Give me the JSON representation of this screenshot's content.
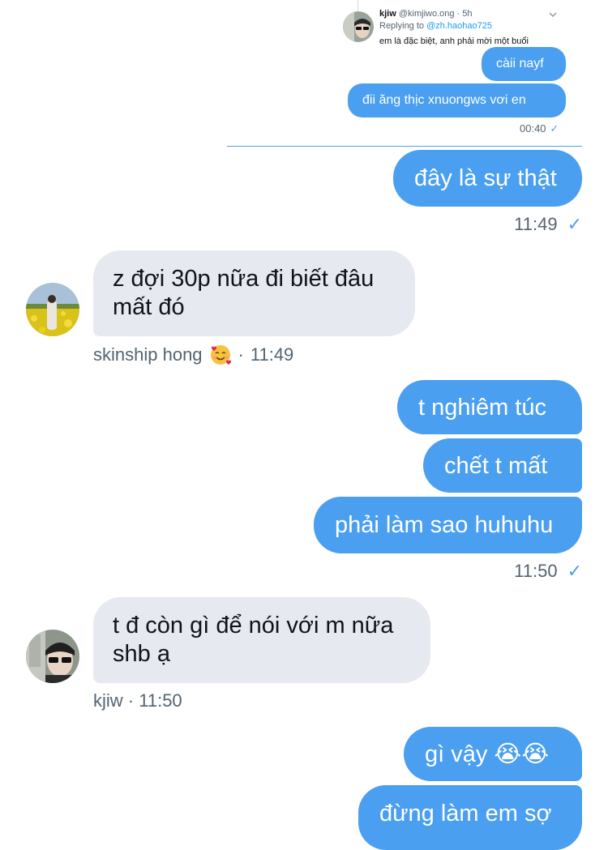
{
  "quoted": {
    "author": "kjiw",
    "handle": "@kimjiwo.ong · 5h",
    "replying_prefix": "Replying to ",
    "replying_to": "@zh.haohao725",
    "text": "em là đặc biệt, anh phải mời một buổi",
    "messages": [
      "càii nayf",
      "đii ăng thịc xnuongws vơi en"
    ],
    "time": "00:40"
  },
  "messages": [
    {
      "text": "đây là sự thật"
    },
    {
      "meta": "11:49"
    },
    {
      "text": "z đợi 30p nữa đi biết đâu mất đó"
    },
    {
      "sender": "skinship hong",
      "time": "11:49"
    },
    {
      "text": "t nghiêm túc"
    },
    {
      "text": "chết t mất"
    },
    {
      "text": "phải làm sao huhuhu"
    },
    {
      "meta": "11:50"
    },
    {
      "text": "t đ còn gì để nói với m nữa shb ạ"
    },
    {
      "sender": "kjiw",
      "time": "11:50"
    },
    {
      "text": "gì vậy 😭😭"
    },
    {
      "text": "đừng làm em sợ"
    }
  ],
  "icons": {
    "check": "checkmark-icon",
    "chevron": "chevron-down-icon",
    "emoji_hearts": "smiling-face-hearts-emoji"
  },
  "colors": {
    "accent": "#4a9ff0",
    "incoming_bubble": "#e6e9ef",
    "meta_text": "#536471"
  }
}
